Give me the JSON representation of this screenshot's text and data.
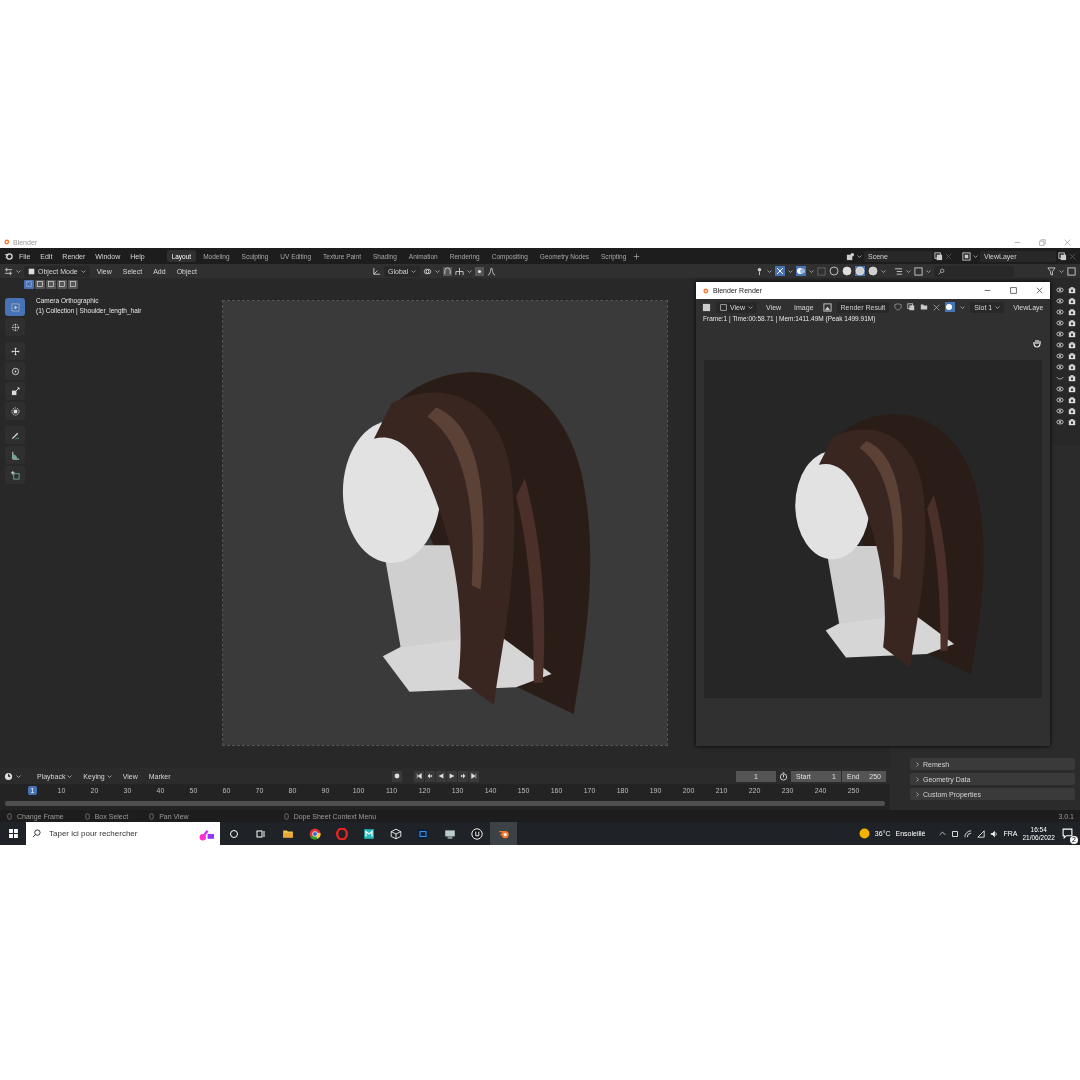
{
  "window": {
    "title": "Blender"
  },
  "menu": [
    "File",
    "Edit",
    "Render",
    "Window",
    "Help"
  ],
  "workspaces": [
    {
      "label": "Layout",
      "selected": true
    },
    {
      "label": "Modeling",
      "selected": false
    },
    {
      "label": "Sculpting",
      "selected": false
    },
    {
      "label": "UV Editing",
      "selected": false
    },
    {
      "label": "Texture Paint",
      "selected": false
    },
    {
      "label": "Shading",
      "selected": false
    },
    {
      "label": "Animation",
      "selected": false
    },
    {
      "label": "Rendering",
      "selected": false
    },
    {
      "label": "Compositing",
      "selected": false
    },
    {
      "label": "Geometry Nodes",
      "selected": false
    },
    {
      "label": "Scripting",
      "selected": false
    }
  ],
  "scene": "Scene",
  "view_layer": "ViewLayer",
  "viewport": {
    "mode": "Object Mode",
    "menus": [
      "View",
      "Select",
      "Add",
      "Object"
    ],
    "orientation": "Global",
    "select_modes": [
      {
        "selected": true
      },
      {
        "selected": false
      },
      {
        "selected": false
      },
      {
        "selected": false
      },
      {
        "selected": false
      }
    ],
    "shading": [
      {
        "selected": false
      },
      {
        "selected": false
      },
      {
        "selected": true
      },
      {
        "selected": false
      }
    ],
    "overlay_lines": [
      "Camera Orthographic",
      "(1) Collection | Shoulder_length_hair"
    ],
    "tools": [
      {
        "kind": "select",
        "selected": true
      },
      {
        "kind": "cursor",
        "selected": false
      },
      {
        "kind": "move",
        "selected": false
      },
      {
        "kind": "rotate",
        "selected": false
      },
      {
        "kind": "scale",
        "selected": false
      },
      {
        "kind": "transform",
        "selected": false
      },
      {
        "kind": "annotate",
        "selected": false
      },
      {
        "kind": "measure",
        "selected": false
      },
      {
        "kind": "add",
        "selected": false
      }
    ]
  },
  "render_window": {
    "title": "Blender Render",
    "view_dropdown": "View",
    "menus": [
      "View",
      "Image"
    ],
    "image_name": "Render Result",
    "slot": "Slot 1",
    "view_layer": "ViewLaye",
    "stats": "Frame:1 | Time:00:58.71 | Mem:1411.49M (Peak 1499.91M)"
  },
  "outliner": {
    "rows": [
      {
        "visible": true
      },
      {
        "visible": true
      },
      {
        "visible": true
      },
      {
        "visible": true
      },
      {
        "visible": true
      },
      {
        "visible": true
      },
      {
        "visible": true
      },
      {
        "visible": true
      },
      {
        "visible": false
      },
      {
        "visible": true
      },
      {
        "visible": true
      },
      {
        "visible": true
      },
      {
        "visible": true
      }
    ]
  },
  "properties": {
    "panels": [
      "Remesh",
      "Geometry Data",
      "Custom Properties"
    ]
  },
  "timeline": {
    "menus": [
      {
        "label": "Playback",
        "dropdown": true
      },
      {
        "label": "Keying",
        "dropdown": true
      },
      {
        "label": "View",
        "dropdown": false
      },
      {
        "label": "Marker",
        "dropdown": false
      }
    ],
    "current_frame": "1",
    "start_label": "Start",
    "start": "1",
    "end_label": "End",
    "end": "250",
    "ticks": [
      {
        "label": "1",
        "selected": true
      },
      {
        "label": "10",
        "selected": false
      },
      {
        "label": "20",
        "selected": false
      },
      {
        "label": "30",
        "selected": false
      },
      {
        "label": "40",
        "selected": false
      },
      {
        "label": "50",
        "selected": false
      },
      {
        "label": "60",
        "selected": false
      },
      {
        "label": "70",
        "selected": false
      },
      {
        "label": "80",
        "selected": false
      },
      {
        "label": "90",
        "selected": false
      },
      {
        "label": "100",
        "selected": false
      },
      {
        "label": "110",
        "selected": false
      },
      {
        "label": "120",
        "selected": false
      },
      {
        "label": "130",
        "selected": false
      },
      {
        "label": "140",
        "selected": false
      },
      {
        "label": "150",
        "selected": false
      },
      {
        "label": "160",
        "selected": false
      },
      {
        "label": "170",
        "selected": false
      },
      {
        "label": "180",
        "selected": false
      },
      {
        "label": "190",
        "selected": false
      },
      {
        "label": "200",
        "selected": false
      },
      {
        "label": "210",
        "selected": false
      },
      {
        "label": "220",
        "selected": false
      },
      {
        "label": "230",
        "selected": false
      },
      {
        "label": "240",
        "selected": false
      },
      {
        "label": "250",
        "selected": false
      }
    ]
  },
  "status_bar": {
    "hints": [
      "Change Frame",
      "Box Select",
      "Pan View",
      "Dope Sheet Context Menu"
    ],
    "version": "3.0.1"
  },
  "taskbar": {
    "search_placeholder": "Taper ici pour rechercher",
    "apps": [
      {
        "kind": "folder",
        "selected": false
      },
      {
        "kind": "chrome",
        "selected": false
      },
      {
        "kind": "opera",
        "selected": false
      },
      {
        "kind": "tile",
        "selected": false
      },
      {
        "kind": "cube",
        "selected": false
      },
      {
        "kind": "ps",
        "selected": false
      },
      {
        "kind": "monitor",
        "selected": false
      },
      {
        "kind": "unreal",
        "selected": false
      },
      {
        "kind": "blender",
        "selected": true
      }
    ],
    "temperature": "36°C",
    "weather": "Ensoleillé",
    "language": "FRA",
    "time": "16:54",
    "date": "21/06/2022",
    "notifications": "2"
  }
}
